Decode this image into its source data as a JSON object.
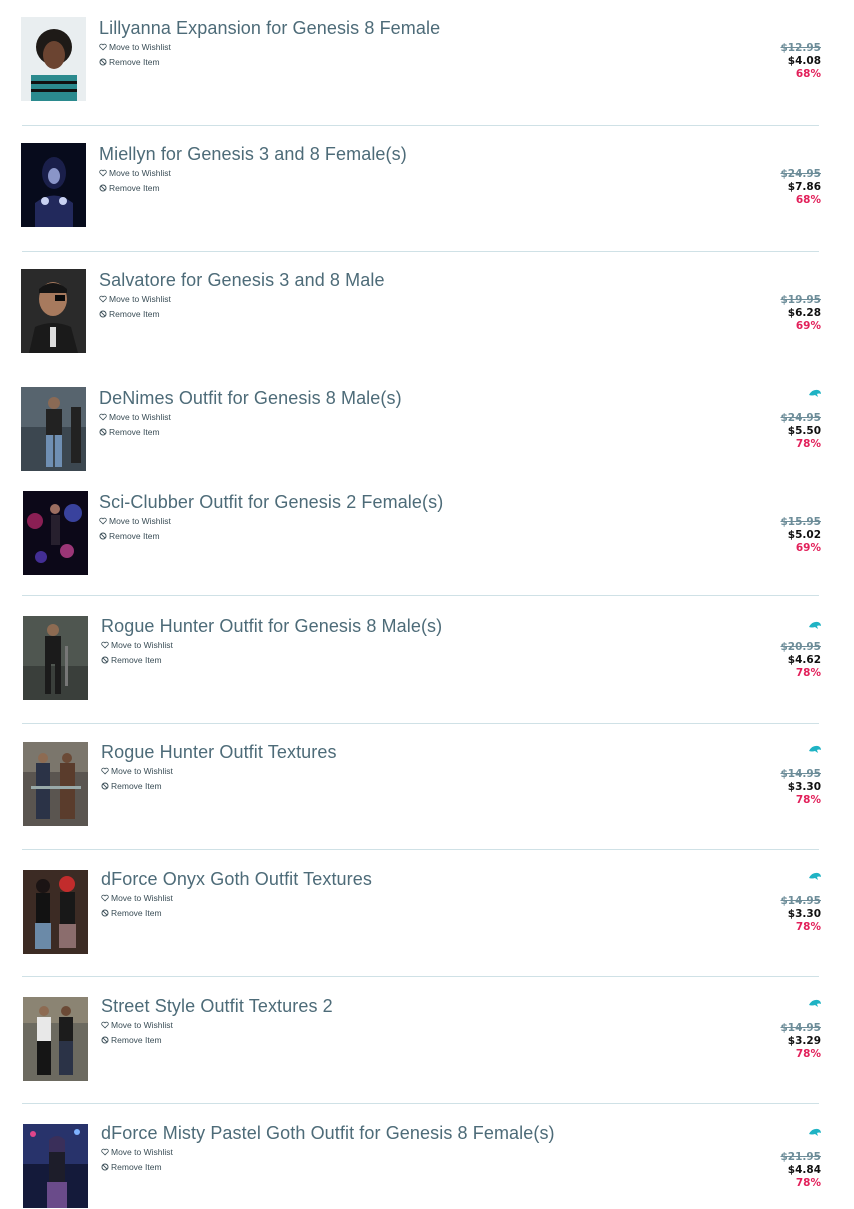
{
  "cart": {
    "items": [
      {
        "title": "Lillyanna Expansion for Genesis 8 Female",
        "wishlist": "Move to Wishlist",
        "remove": "Remove Item",
        "original_price": "$12.95",
        "price": "$4.08",
        "discount": "68%",
        "badge": false
      },
      {
        "title": "Miellyn for Genesis 3 and 8 Female(s)",
        "wishlist": "Move to Wishlist",
        "remove": "Remove Item",
        "original_price": "$24.95",
        "price": "$7.86",
        "discount": "68%",
        "badge": false
      },
      {
        "title": "Salvatore for Genesis 3 and 8 Male",
        "wishlist": "Move to Wishlist",
        "remove": "Remove Item",
        "original_price": "$19.95",
        "price": "$6.28",
        "discount": "69%",
        "badge": false
      },
      {
        "title": "DeNimes Outfit for Genesis 8 Male(s)",
        "wishlist": "Move to Wishlist",
        "remove": "Remove Item",
        "original_price": "$24.95",
        "price": "$5.50",
        "discount": "78%",
        "badge": true
      },
      {
        "title": "Sci-Clubber Outfit for Genesis 2 Female(s)",
        "wishlist": "Move to Wishlist",
        "remove": "Remove Item",
        "original_price": "$15.95",
        "price": "$5.02",
        "discount": "69%",
        "badge": false
      },
      {
        "title": "Rogue Hunter Outfit for Genesis 8 Male(s)",
        "wishlist": "Move to Wishlist",
        "remove": "Remove Item",
        "original_price": "$20.95",
        "price": "$4.62",
        "discount": "78%",
        "badge": true
      },
      {
        "title": "Rogue Hunter Outfit Textures",
        "wishlist": "Move to Wishlist",
        "remove": "Remove Item",
        "original_price": "$14.95",
        "price": "$3.30",
        "discount": "78%",
        "badge": true
      },
      {
        "title": "dForce Onyx Goth Outfit Textures",
        "wishlist": "Move to Wishlist",
        "remove": "Remove Item",
        "original_price": "$14.95",
        "price": "$3.30",
        "discount": "78%",
        "badge": true
      },
      {
        "title": "Street Style Outfit Textures 2",
        "wishlist": "Move to Wishlist",
        "remove": "Remove Item",
        "original_price": "$14.95",
        "price": "$3.29",
        "discount": "78%",
        "badge": true
      },
      {
        "title": "dForce Misty Pastel Goth Outfit for Genesis 8 Female(s)",
        "wishlist": "Move to Wishlist",
        "remove": "Remove Item",
        "original_price": "$21.95",
        "price": "$4.84",
        "discount": "78%",
        "badge": true
      }
    ]
  },
  "colors": {
    "title": "#4d6b78",
    "original_price": "#6d8d99",
    "discount": "#e2205a",
    "badge": "#1fb3c4",
    "divider": "#cfe1e6"
  },
  "icons": {
    "wishlist": "heart-outline-icon",
    "remove": "prohibit-icon",
    "badge": "dolphin-badge-icon"
  }
}
